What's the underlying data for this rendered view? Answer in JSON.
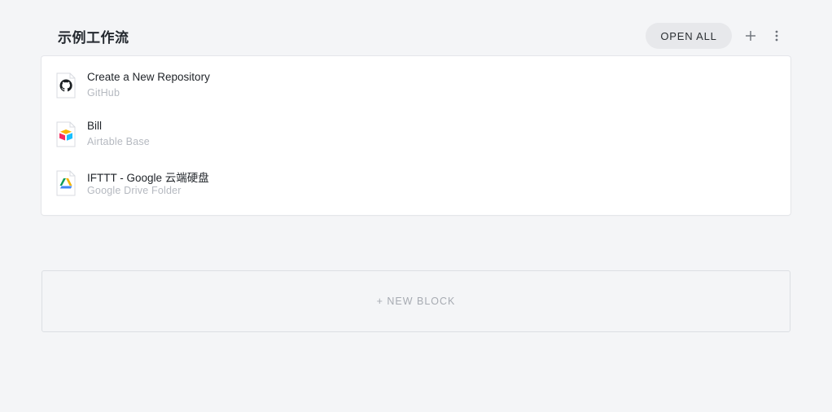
{
  "header": {
    "title": "示例工作流",
    "open_all_label": "OPEN ALL"
  },
  "items": [
    {
      "title": "Create a New Repository",
      "subtitle": "GitHub",
      "icon": "github-icon"
    },
    {
      "title": "Bill",
      "subtitle": "Airtable Base",
      "icon": "airtable-icon"
    },
    {
      "title": "IFTTT - Google 云端硬盘",
      "subtitle": "Google Drive Folder",
      "icon": "google-drive-icon"
    }
  ],
  "new_block_label": "+ NEW BLOCK",
  "colors": {
    "background": "#f4f5f7",
    "card": "#ffffff",
    "pill": "#e7e8eb",
    "muted_text": "#b5b9c0"
  }
}
